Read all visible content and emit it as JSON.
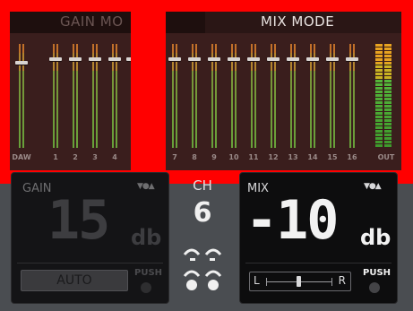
{
  "gain_mode": {
    "title": "GAIN MO",
    "channels": [
      {
        "label": "DAW",
        "meter": "stereo"
      },
      {
        "label": "1",
        "meter": "stereo"
      },
      {
        "label": "2",
        "meter": "stereo"
      },
      {
        "label": "3",
        "meter": "stereo"
      },
      {
        "label": "4",
        "meter": "stereo"
      }
    ]
  },
  "mix_mode": {
    "title": "MIX MODE",
    "channels": [
      {
        "label": "7"
      },
      {
        "label": "8"
      },
      {
        "label": "9"
      },
      {
        "label": "10"
      },
      {
        "label": "11"
      },
      {
        "label": "12"
      },
      {
        "label": "13"
      },
      {
        "label": "14"
      },
      {
        "label": "15"
      },
      {
        "label": "16"
      }
    ],
    "out_label": "OUT"
  },
  "gain_control": {
    "label": "GAIN",
    "value": "15",
    "unit": "db",
    "auto_label": "AUTO",
    "push_label": "PUSH",
    "stepper_icon": "down-dot-up-icon"
  },
  "channel": {
    "label": "CH",
    "number": "6",
    "link_icons": [
      "linked-up-icon",
      "linked-down-icon"
    ]
  },
  "mix_control": {
    "label": "MIX",
    "value": "-10",
    "unit": "db",
    "pan_left": "L",
    "pan_right": "R",
    "push_label": "PUSH",
    "stepper_icon": "down-dot-up-icon"
  },
  "colors": {
    "highlight": "#ff0000",
    "panel_bg": "#3a1e1d",
    "meter_green": "#6aa83c",
    "meter_orange": "#c8742a",
    "control_bg": "#0d0d0e",
    "page_bg": "#4a4d51"
  }
}
